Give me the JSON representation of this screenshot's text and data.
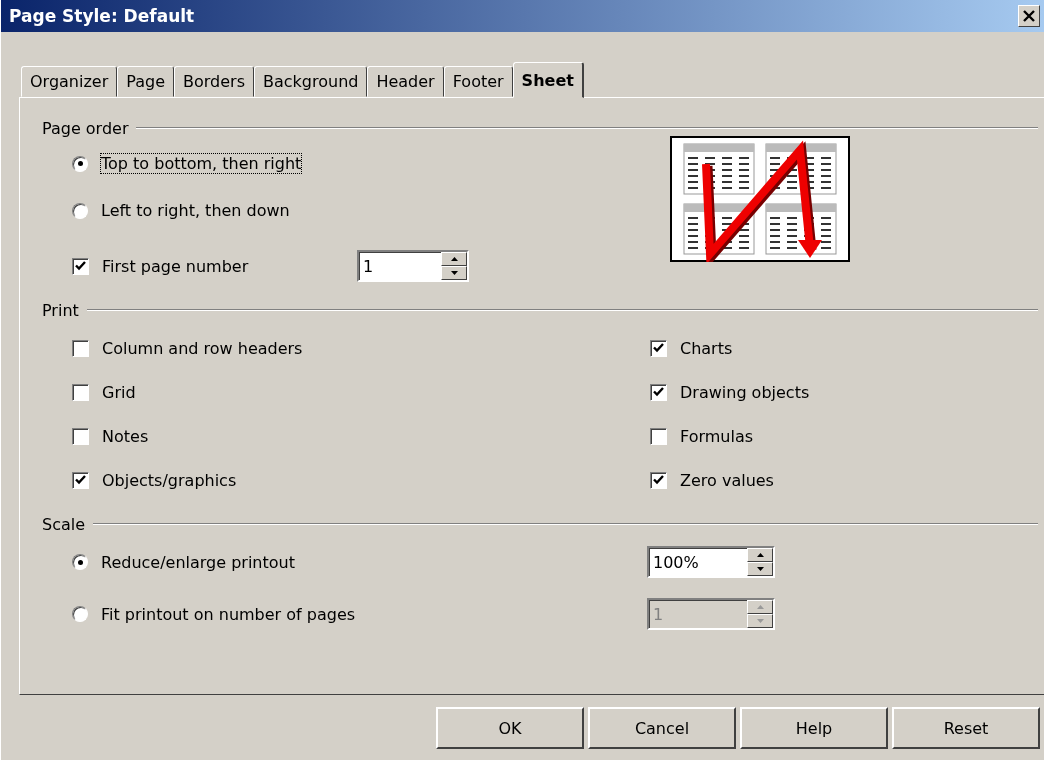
{
  "window": {
    "title": "Page Style: Default"
  },
  "tabs": [
    {
      "label": "Organizer",
      "selected": false
    },
    {
      "label": "Page",
      "selected": false
    },
    {
      "label": "Borders",
      "selected": false
    },
    {
      "label": "Background",
      "selected": false
    },
    {
      "label": "Header",
      "selected": false
    },
    {
      "label": "Footer",
      "selected": false
    },
    {
      "label": "Sheet",
      "selected": true
    }
  ],
  "page_order": {
    "title": "Page order",
    "options": [
      {
        "label": "Top to bottom, then right",
        "selected": true,
        "focused": true
      },
      {
        "label": "Left to right, then down",
        "selected": false,
        "focused": false
      }
    ],
    "first_page_number": {
      "label": "First page number",
      "checked": true,
      "value": "1"
    }
  },
  "print": {
    "title": "Print",
    "options": [
      {
        "label": "Column and row headers",
        "checked": false
      },
      {
        "label": "Grid",
        "checked": false
      },
      {
        "label": "Notes",
        "checked": false
      },
      {
        "label": "Objects/graphics",
        "checked": true
      },
      {
        "label": "Charts",
        "checked": true
      },
      {
        "label": "Drawing objects",
        "checked": true
      },
      {
        "label": "Formulas",
        "checked": false
      },
      {
        "label": "Zero values",
        "checked": true
      }
    ]
  },
  "scale": {
    "title": "Scale",
    "options": [
      {
        "label": "Reduce/enlarge printout",
        "selected": true,
        "field": {
          "value": "100%",
          "disabled": false
        }
      },
      {
        "label": "Fit printout on number of pages",
        "selected": false,
        "field": {
          "value": "1",
          "disabled": true
        }
      }
    ]
  },
  "buttons": [
    {
      "label": "OK"
    },
    {
      "label": "Cancel"
    },
    {
      "label": "Help"
    },
    {
      "label": "Reset"
    }
  ]
}
